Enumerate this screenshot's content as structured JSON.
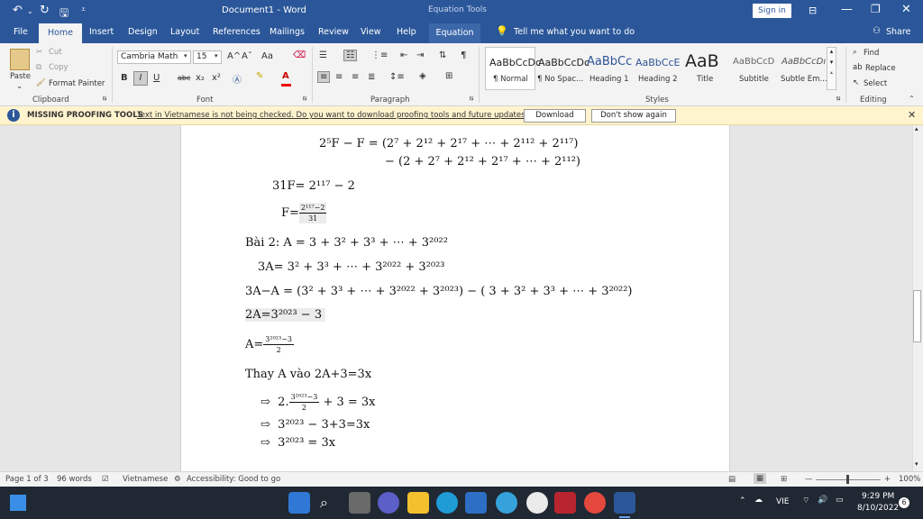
{
  "titlebar": {
    "document_title": "Document1 - Word",
    "context_tab_group": "Equation Tools",
    "sign_in": "Sign in"
  },
  "tabs": [
    {
      "label": "File"
    },
    {
      "label": "Home"
    },
    {
      "label": "Insert"
    },
    {
      "label": "Design"
    },
    {
      "label": "Layout"
    },
    {
      "label": "References"
    },
    {
      "label": "Mailings"
    },
    {
      "label": "Review"
    },
    {
      "label": "View"
    },
    {
      "label": "Help"
    },
    {
      "label": "Equation"
    }
  ],
  "tell_me": "Tell me what you want to do",
  "share": "Share",
  "clipboard": {
    "paste": "Paste",
    "cut": "Cut",
    "copy": "Copy",
    "format_painter": "Format Painter",
    "group": "Clipboard"
  },
  "font": {
    "name": "Cambria Math",
    "size": "15",
    "group": "Font",
    "bold": "B",
    "italic": "I",
    "underline": "U",
    "strike": "abc",
    "sub": "x₂",
    "sup": "x²",
    "aa": "Aa",
    "grow": "A^",
    "shrink": "Aˇ"
  },
  "paragraph": {
    "group": "Paragraph"
  },
  "styles": {
    "group": "Styles",
    "items": [
      {
        "preview": "AaBbCcDc",
        "name": "¶ Normal"
      },
      {
        "preview": "AaBbCcDc",
        "name": "¶ No Spac..."
      },
      {
        "preview": "AaBbCc",
        "name": "Heading 1"
      },
      {
        "preview": "AaBbCcE",
        "name": "Heading 2"
      },
      {
        "preview": "AaB",
        "name": "Title"
      },
      {
        "preview": "AaBbCcD",
        "name": "Subtitle"
      },
      {
        "preview": "AaBbCcDı",
        "name": "Subtle Em..."
      }
    ]
  },
  "editing": {
    "find": "Find",
    "replace": "Replace",
    "select": "Select",
    "group": "Editing"
  },
  "message_bar": {
    "title": "MISSING PROOFING TOOLS",
    "text": "Text in Vietnamese is not being checked. Do you want to download proofing tools and future updates?",
    "download": "Download",
    "dont_show": "Don't show again"
  },
  "document": {
    "l1_lhs": "2⁵F − F = (2⁷ + 2¹² + 2¹⁷ + ⋯ + 2¹¹²   + 2¹¹⁷)",
    "l1_rhs": "− (2 + 2⁷ + 2¹² + 2¹⁷ + ⋯ + 2¹¹²)",
    "l2": "31F= 2¹¹⁷ − 2",
    "l3_prefix": "F=",
    "l3_num": "2¹¹⁷−2",
    "l3_den": "31",
    "l4": "Bài 2: A = 3 + 3² + 3³ + ⋯ + 3²⁰²²",
    "l5": "3A= 3² + 3³ + ⋯ + 3²⁰²² + 3²⁰²³",
    "l6": "3A−A = (3² + 3³ + ⋯ + 3²⁰²² + 3²⁰²³) − ( 3 + 3² + 3³ + ⋯ + 3²⁰²²)",
    "l7": "2A=3²⁰²³ − 3",
    "l8_prefix": "A=",
    "l8_num": "3²⁰²³−3",
    "l8_den": "2",
    "l9": "Thay A vào 2A+3=3x",
    "b1_prefix": "2.",
    "b1_num": "3²⁰²³−3",
    "b1_den": "2",
    "b1_suffix": "+ 3 = 3x",
    "b2": "3²⁰²³ − 3+3=3x",
    "b3": "3²⁰²³ = 3x",
    "arrow": "⇨"
  },
  "status": {
    "page": "Page 1 of 3",
    "words": "96 words",
    "language": "Vietnamese",
    "accessibility": "Accessibility: Good to go",
    "zoom": "100%"
  },
  "taskbar": {
    "lang": "VIE",
    "time": "9:29 PM",
    "date": "8/10/2022",
    "badge": "6"
  }
}
